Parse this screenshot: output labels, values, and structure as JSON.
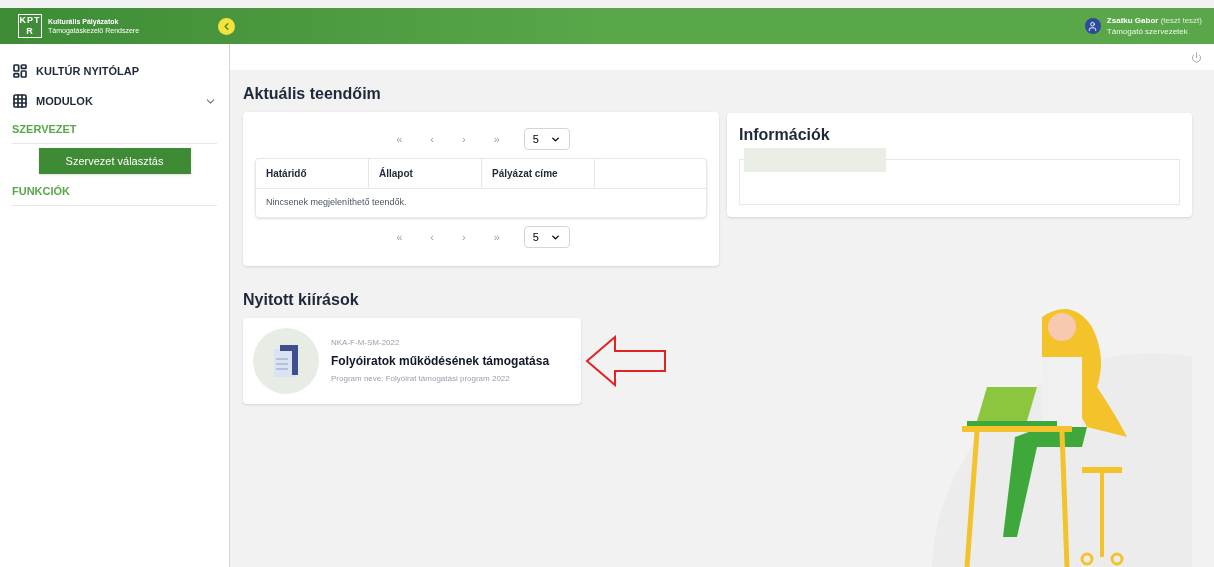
{
  "header": {
    "brand_line_1": "Kulturális Pályázatok",
    "brand_line_2": "Támogatáskezelő Rendszere",
    "logo": "KPTR",
    "user_name": "Zsatku Gabor",
    "user_note": "(teszt teszt)",
    "user_role": "Támogató szervezetek"
  },
  "sidebar": {
    "items": [
      {
        "kind": "link",
        "label": "KULTÚR NYITÓLAP"
      },
      {
        "kind": "link",
        "label": "MODULOK",
        "expanded": false
      },
      {
        "kind": "section",
        "label": "SZERVEZET"
      },
      {
        "kind": "button",
        "label": "Szervezet választás"
      },
      {
        "kind": "section",
        "label": "FUNKCIÓK"
      }
    ]
  },
  "todos": {
    "title": "Aktuális teendőim",
    "top_pager": {
      "first": "«",
      "prev": "‹",
      "next": "›",
      "last": "»",
      "page_size": "5"
    },
    "bottom_pager": {
      "first": "«",
      "prev": "‹",
      "next": "›",
      "last": "»",
      "page_size": "5"
    },
    "table": {
      "columns": [
        "Határidő",
        "Állapot",
        "Pályázat címe"
      ],
      "empty_message": "Nincsenek megjeleníthető teendők."
    }
  },
  "info": {
    "title": "Információk"
  },
  "open_calls": {
    "title": "Nyitott kiírások",
    "cards": [
      {
        "code": "NKA-F-M-SM-2022",
        "title": "Folyóiratok működésének támogatása",
        "subtitle": "Program neve: Folyóirat támogatási program 2022"
      }
    ]
  }
}
